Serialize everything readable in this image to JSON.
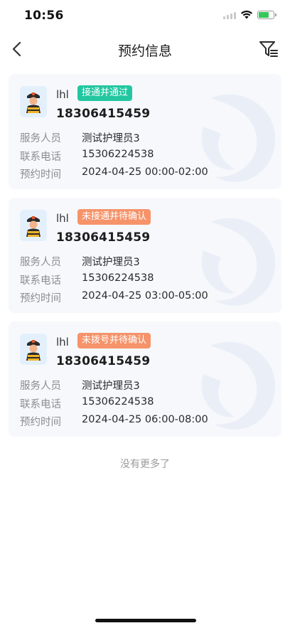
{
  "status_bar": {
    "time": "10:56",
    "battery_level": 0.7,
    "battery_color": "#34c759"
  },
  "nav": {
    "title": "预约信息",
    "back_icon": "chevron-left-icon",
    "filter_icon": "filter-icon"
  },
  "colors": {
    "badge_green": "#22c7a0",
    "badge_orange": "#f6936a",
    "card_bg": "#f6f8fc"
  },
  "labels": {
    "staff": "服务人员",
    "phone": "联系电话",
    "time": "预约时间"
  },
  "appointments": [
    {
      "name": "lhl",
      "status": "接通并通过",
      "status_color": "#22c7a0",
      "phone": "18306415459",
      "staff": "测试护理员3",
      "contact": "15306224538",
      "time": "2024-04-25 00:00-02:00"
    },
    {
      "name": "lhl",
      "status": "未接通并待确认",
      "status_color": "#f6936a",
      "phone": "18306415459",
      "staff": "测试护理员3",
      "contact": "15306224538",
      "time": "2024-04-25 03:00-05:00"
    },
    {
      "name": "lhl",
      "status": "未拨号并待确认",
      "status_color": "#f6936a",
      "phone": "18306415459",
      "staff": "测试护理员3",
      "contact": "15306224538",
      "time": "2024-04-25 06:00-08:00"
    }
  ],
  "footer": {
    "no_more": "没有更多了"
  }
}
